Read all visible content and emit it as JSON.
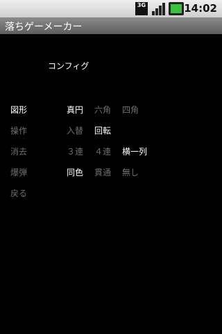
{
  "status_bar": {
    "network_label": "3G",
    "time": "14:02",
    "icons": [
      "network-3g-icon",
      "signal-strength-icon",
      "battery-charging-icon"
    ]
  },
  "app": {
    "title": "落ちゲーメーカー"
  },
  "screen": {
    "heading": "コンフィグ"
  },
  "config": {
    "shape": {
      "label": "図形",
      "options": [
        {
          "text": "真円",
          "selected": true
        },
        {
          "text": "六角",
          "selected": false
        },
        {
          "text": "四角",
          "selected": false
        }
      ]
    },
    "control": {
      "label": "操作",
      "options": [
        {
          "text": "入替",
          "selected": false
        },
        {
          "text": "回転",
          "selected": true
        }
      ]
    },
    "clear": {
      "label": "消去",
      "options": [
        {
          "text": "３連",
          "selected": false
        },
        {
          "text": "４連",
          "selected": false
        },
        {
          "text": "横一列",
          "selected": true
        }
      ]
    },
    "bomb": {
      "label": "爆弾",
      "options": [
        {
          "text": "同色",
          "selected": true
        },
        {
          "text": "貫通",
          "selected": false
        },
        {
          "text": "無し",
          "selected": false
        }
      ]
    },
    "back": {
      "label": "戻る"
    }
  },
  "colors": {
    "selected": "#ffffff",
    "unselected": "#6e6e6e",
    "background": "#000000"
  }
}
